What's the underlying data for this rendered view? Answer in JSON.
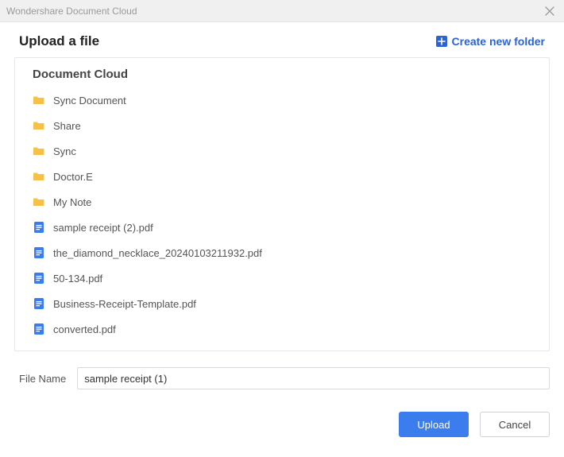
{
  "window": {
    "title": "Wondershare Document Cloud"
  },
  "header": {
    "title": "Upload a file",
    "create_folder_label": "Create new folder"
  },
  "panel": {
    "title": "Document Cloud",
    "items": [
      {
        "type": "folder",
        "name": "Sync Document"
      },
      {
        "type": "folder",
        "name": "Share"
      },
      {
        "type": "folder",
        "name": "Sync"
      },
      {
        "type": "folder",
        "name": "Doctor.E"
      },
      {
        "type": "folder",
        "name": "My Note"
      },
      {
        "type": "file",
        "name": "sample receipt (2).pdf"
      },
      {
        "type": "file",
        "name": "the_diamond_necklace_20240103211932.pdf"
      },
      {
        "type": "file",
        "name": "50-134.pdf"
      },
      {
        "type": "file",
        "name": "Business-Receipt-Template.pdf"
      },
      {
        "type": "file",
        "name": "converted.pdf"
      }
    ]
  },
  "filename": {
    "label": "File Name",
    "value": "sample receipt (1)"
  },
  "footer": {
    "upload_label": "Upload",
    "cancel_label": "Cancel"
  },
  "colors": {
    "accent": "#3b7ded",
    "link": "#2b62d6",
    "folder": "#f4c24b",
    "file": "#3b7ded"
  }
}
